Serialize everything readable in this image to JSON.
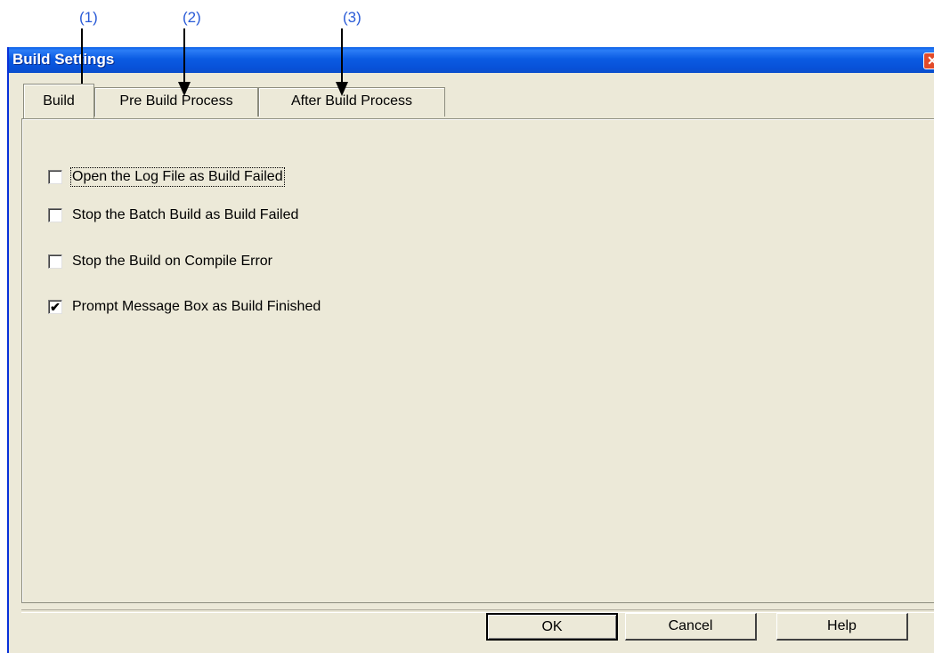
{
  "callouts": [
    "(1)",
    "(2)",
    "(3)"
  ],
  "window": {
    "title": "Build Settings",
    "close_glyph": "✕"
  },
  "tabs": [
    {
      "label": "Build",
      "active": true
    },
    {
      "label": "Pre Build Process",
      "active": false
    },
    {
      "label": "After Build Process",
      "active": false
    }
  ],
  "options": [
    {
      "label": "Open the Log File as Build Failed",
      "checked": false
    },
    {
      "label": "Stop the Batch Build as Build Failed",
      "checked": false
    },
    {
      "label": "Stop the Build on Compile Error",
      "checked": false
    },
    {
      "label": "Prompt Message Box as Build Finished",
      "checked": true
    }
  ],
  "buttons": {
    "ok": "OK",
    "cancel": "Cancel",
    "help": "Help"
  },
  "colors": {
    "callout": "#2a5bd7",
    "titlebar": "#0a5fe8",
    "dialog_bg": "#ece9d8"
  }
}
